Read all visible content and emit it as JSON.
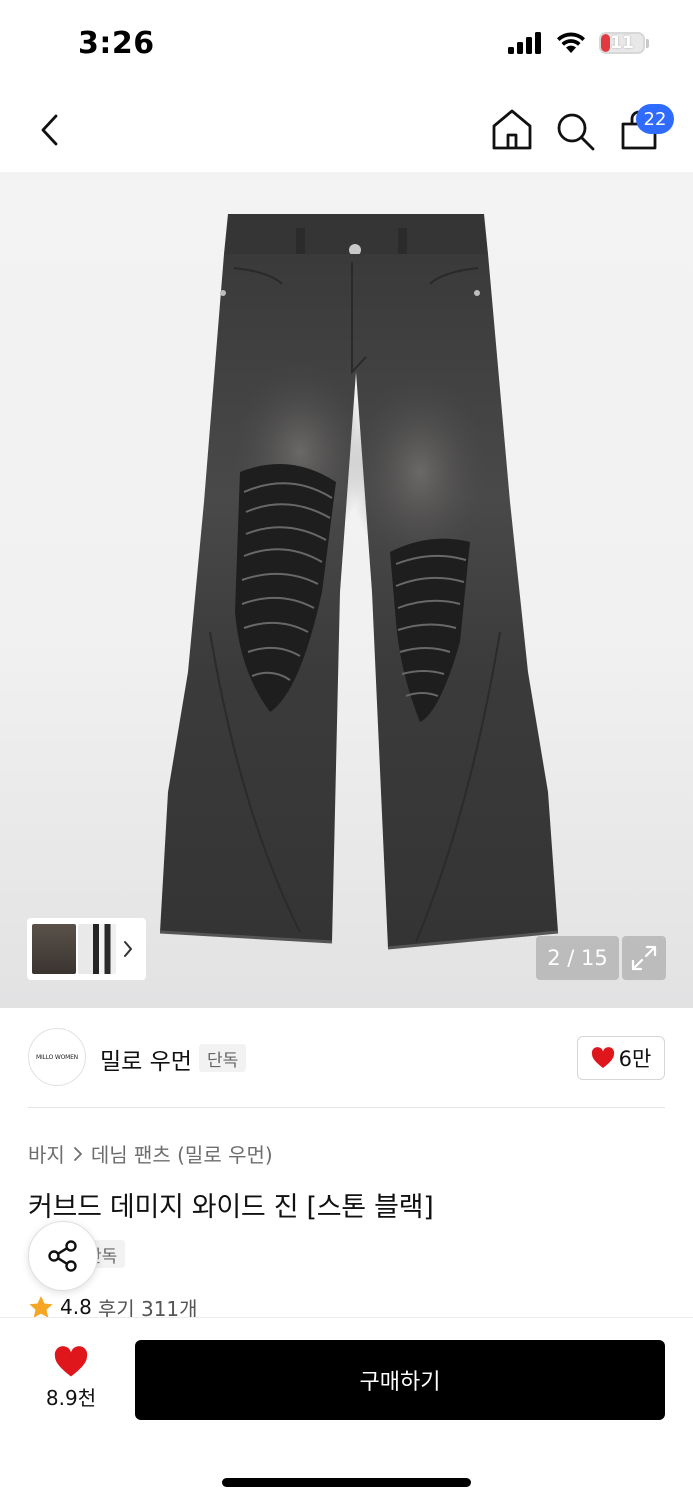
{
  "status_bar": {
    "time": "3:26",
    "battery": "11",
    "battery_level": 0.11,
    "icons": [
      "cellular-signal-icon",
      "wifi-icon",
      "battery-icon"
    ]
  },
  "nav": {
    "back_icon": "chevron-left-icon",
    "home_icon": "home-icon",
    "search_icon": "search-icon",
    "cart_icon": "shopping-bag-icon",
    "cart_badge": "22",
    "badge_color": "#2f6bff"
  },
  "gallery": {
    "counter": "2 / 15",
    "expand_icon": "expand-icon",
    "thumbnail_chevron": "chevron-right-icon"
  },
  "brand": {
    "logo_text": "MILLO WOMEN",
    "name": "밀로 우먼",
    "tag": "단독",
    "likes": "6만",
    "like_icon": "heart-icon",
    "like_color": "#e0161d"
  },
  "product": {
    "breadcrumb": [
      "바지",
      "데님 팬츠 (밀로 우먼)"
    ],
    "title": "커브드 데미지 와이드 진 [스톤 블랙]",
    "tag": "단독",
    "rating": "4.8",
    "reviews": "후기 311개",
    "star_color": "#f5a623"
  },
  "bottom_bar": {
    "wish_count": "8.9천",
    "buy_label": "구매하기",
    "share_icon": "share-icon"
  }
}
